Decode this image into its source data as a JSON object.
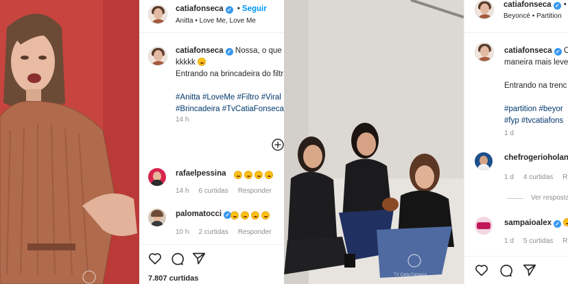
{
  "post1": {
    "username": "catiafonseca",
    "follow_label": "Seguir",
    "separator": "•",
    "audio": "Anitta • Love Me, Love Me",
    "caption_line1": "Nossa, o que se",
    "caption_line2": "kkkkk",
    "caption_line3": "Entrando na brincadeira do filtr",
    "caption_tags1": "#Anitta #LoveMe #Filtro #Viral",
    "caption_tags2": "#Brincadeira #TvCatiaFonseca",
    "time": "14 h",
    "comments": [
      {
        "user": "rafaelpessina",
        "time": "14 h",
        "likes": "6 curtidas",
        "reply": "Responder"
      },
      {
        "user": "palomatocci",
        "time": "10 h",
        "likes": "2 curtidas",
        "reply": "Responder"
      }
    ],
    "likes_count": "7.807 curtidas"
  },
  "post2": {
    "username": "catiafonseca",
    "separator": "•",
    "audio": "Beyoncé • Partition",
    "caption_line1": "O",
    "caption_line2": "maneira mais leve",
    "caption_line3": "Entrando na trenc",
    "caption_tags1": "#partition #beyor",
    "caption_tags2": "#fyp #tvcatiafons",
    "time": "1 d",
    "comments": [
      {
        "user": "chefrogerioholan",
        "time": "1 d",
        "likes": "4 curtidas",
        "reply": "Re"
      },
      {
        "user": "sampaioalex",
        "time": "1 d",
        "likes": "5 curtidas",
        "reply": "Re"
      }
    ],
    "view_replies": "Ver resposta",
    "watermark": "TV Catia Fonseca"
  },
  "colors": {
    "verified": "#3897f0",
    "hashtag": "#00376b",
    "follow": "#0095f6",
    "left_bg": "#c8443f"
  }
}
